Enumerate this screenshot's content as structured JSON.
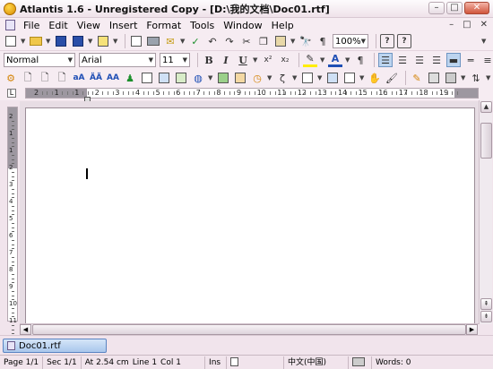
{
  "window": {
    "title": "Atlantis 1.6 - Unregistered Copy - [D:\\我的文档\\Doc01.rtf]",
    "min_glyph": "–",
    "max_glyph": "□",
    "close_glyph": "✕"
  },
  "menu": {
    "items": [
      "File",
      "Edit",
      "View",
      "Insert",
      "Format",
      "Tools",
      "Window",
      "Help"
    ],
    "right_controls": [
      "–",
      "□",
      "✕"
    ]
  },
  "toolbar_standard": {
    "zoom": "100%",
    "zoom_options_arrow": "▼"
  },
  "toolbar_format": {
    "style": "Normal",
    "font": "Arial",
    "size": "11",
    "bold": "B",
    "italic": "I",
    "underline": "U",
    "superscript": "x²",
    "subscript": "x₂"
  },
  "ruler": {
    "labels": [
      "2",
      "1",
      "1",
      "2",
      "3",
      "4",
      "5",
      "6",
      "7",
      "8",
      "9",
      "10",
      "11",
      "12",
      "13",
      "14",
      "15",
      "16",
      "17",
      "18",
      "19"
    ],
    "corner": "L"
  },
  "vruler": {
    "labels": [
      "2",
      "1",
      "1",
      "2",
      "3",
      "4",
      "5",
      "6",
      "7",
      "8",
      "9",
      "10",
      "11"
    ]
  },
  "tabs": [
    {
      "label": "Doc01.rtf",
      "active": true
    }
  ],
  "status": {
    "page": "Page 1/1",
    "section": "Sec 1/1",
    "position": "At 2.54 cm",
    "line": "Line 1",
    "column": "Col 1",
    "mode": "Ins",
    "language": "中文(中国)",
    "words": "Words: 0"
  },
  "colors": {
    "chrome": "#f1e4ec",
    "accent": "#6e95c2"
  },
  "icons": {
    "standard": [
      "new-icon",
      "open-icon",
      "save-icon",
      "save-all-icon",
      "print-preview-icon",
      "print-icon",
      "email-icon",
      "check-icon",
      "undo-icon",
      "redo-icon",
      "cut-icon",
      "copy-icon",
      "paste-icon",
      "find-icon",
      "pilcrow-icon",
      "help-icon",
      "whats-this-icon"
    ],
    "drawing": [
      "autotext-icon",
      "font-color-icon",
      "highlight-icon"
    ]
  }
}
